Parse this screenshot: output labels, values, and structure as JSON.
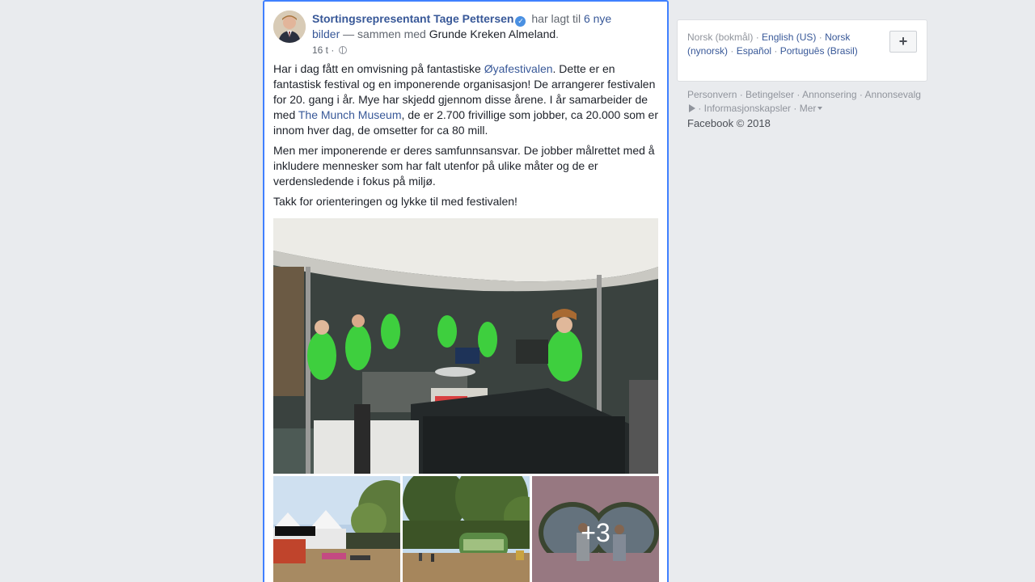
{
  "post": {
    "author": "Stortingsrepresentant Tage Pettersen",
    "verified_mark": "✓",
    "action_text": "har lagt til",
    "new_photos_link": "6 nye bilder",
    "with_text": "— sammen med",
    "tagged_person": "Grunde Kreken Almeland",
    "period": ".",
    "timestamp": "16 t",
    "privacy_icon": "globe-icon",
    "paragraph1": {
      "p1": "Har i dag fått en omvisning på fantastiske ",
      "link1": "Øyafestivalen",
      "p2": ". Dette er en fantastisk festival og en imponerende organisasjon! De arrangerer festivalen for 20. gang i år. Mye har skjedd gjennom disse årene. I år samarbeider de med ",
      "link2": "The Munch Museum",
      "p3": ", de er 2.700 frivillige som jobber, ca 20.000 som er innom hver dag, de omsetter for ca 80 mill."
    },
    "paragraph2": "Men mer imponerende er deres samfunnsansvar. De jobber målrettet med å inkludere mennesker som har falt utenfor på ulike måter og de er verdensledende i fokus på miljø.",
    "paragraph3": "Takk for orienteringen og lykke til med festivalen!",
    "more_photos": "+3"
  },
  "sidebar": {
    "languages": {
      "current": "Norsk (bokmål)",
      "others": [
        "English (US)",
        "Norsk (nynorsk)",
        "Español",
        "Português (Brasil)"
      ],
      "add_label": "+"
    },
    "footer": {
      "links": [
        "Personvern",
        "Betingelser",
        "Annonsering",
        "Annonsevalg",
        "Informasjonskapsler",
        "Mer"
      ],
      "copyright": "Facebook © 2018"
    }
  },
  "colors": {
    "link": "#385898",
    "focus_border": "#4080ff",
    "page_bg": "#e9ebee",
    "tshirt_green": "#3ecf3e"
  }
}
